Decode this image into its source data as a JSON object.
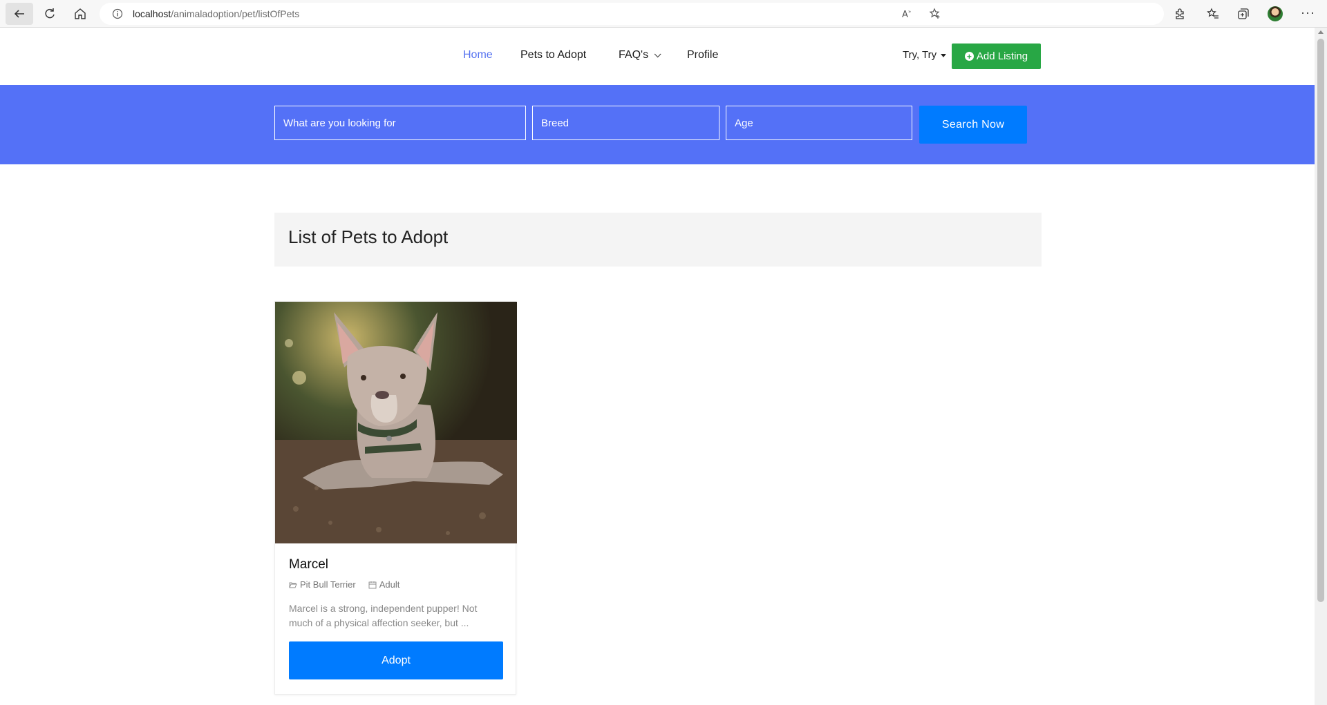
{
  "browser": {
    "url_host": "localhost",
    "url_path": "/animaladoption/pet/listOfPets"
  },
  "nav": {
    "home": "Home",
    "pets_to_adopt": "Pets to Adopt",
    "faqs": "FAQ's",
    "profile": "Profile",
    "user_name": "Try, Try",
    "add_listing": "Add Listing"
  },
  "search": {
    "what_placeholder": "What are you looking for",
    "breed_placeholder": "Breed",
    "age_placeholder": "Age",
    "button": "Search Now"
  },
  "list": {
    "title": "List of Pets to Adopt"
  },
  "pets": [
    {
      "name": "Marcel",
      "breed": "Pit Bull Terrier",
      "age": "Adult",
      "description": "Marcel is a strong, independent pupper! Not much of a physical affection seeker, but ...",
      "adopt_label": "Adopt"
    }
  ],
  "colors": {
    "accent": "#5471f7",
    "primary_button": "#007bff",
    "success_button": "#28a745",
    "active_nav": "#5471f0"
  }
}
